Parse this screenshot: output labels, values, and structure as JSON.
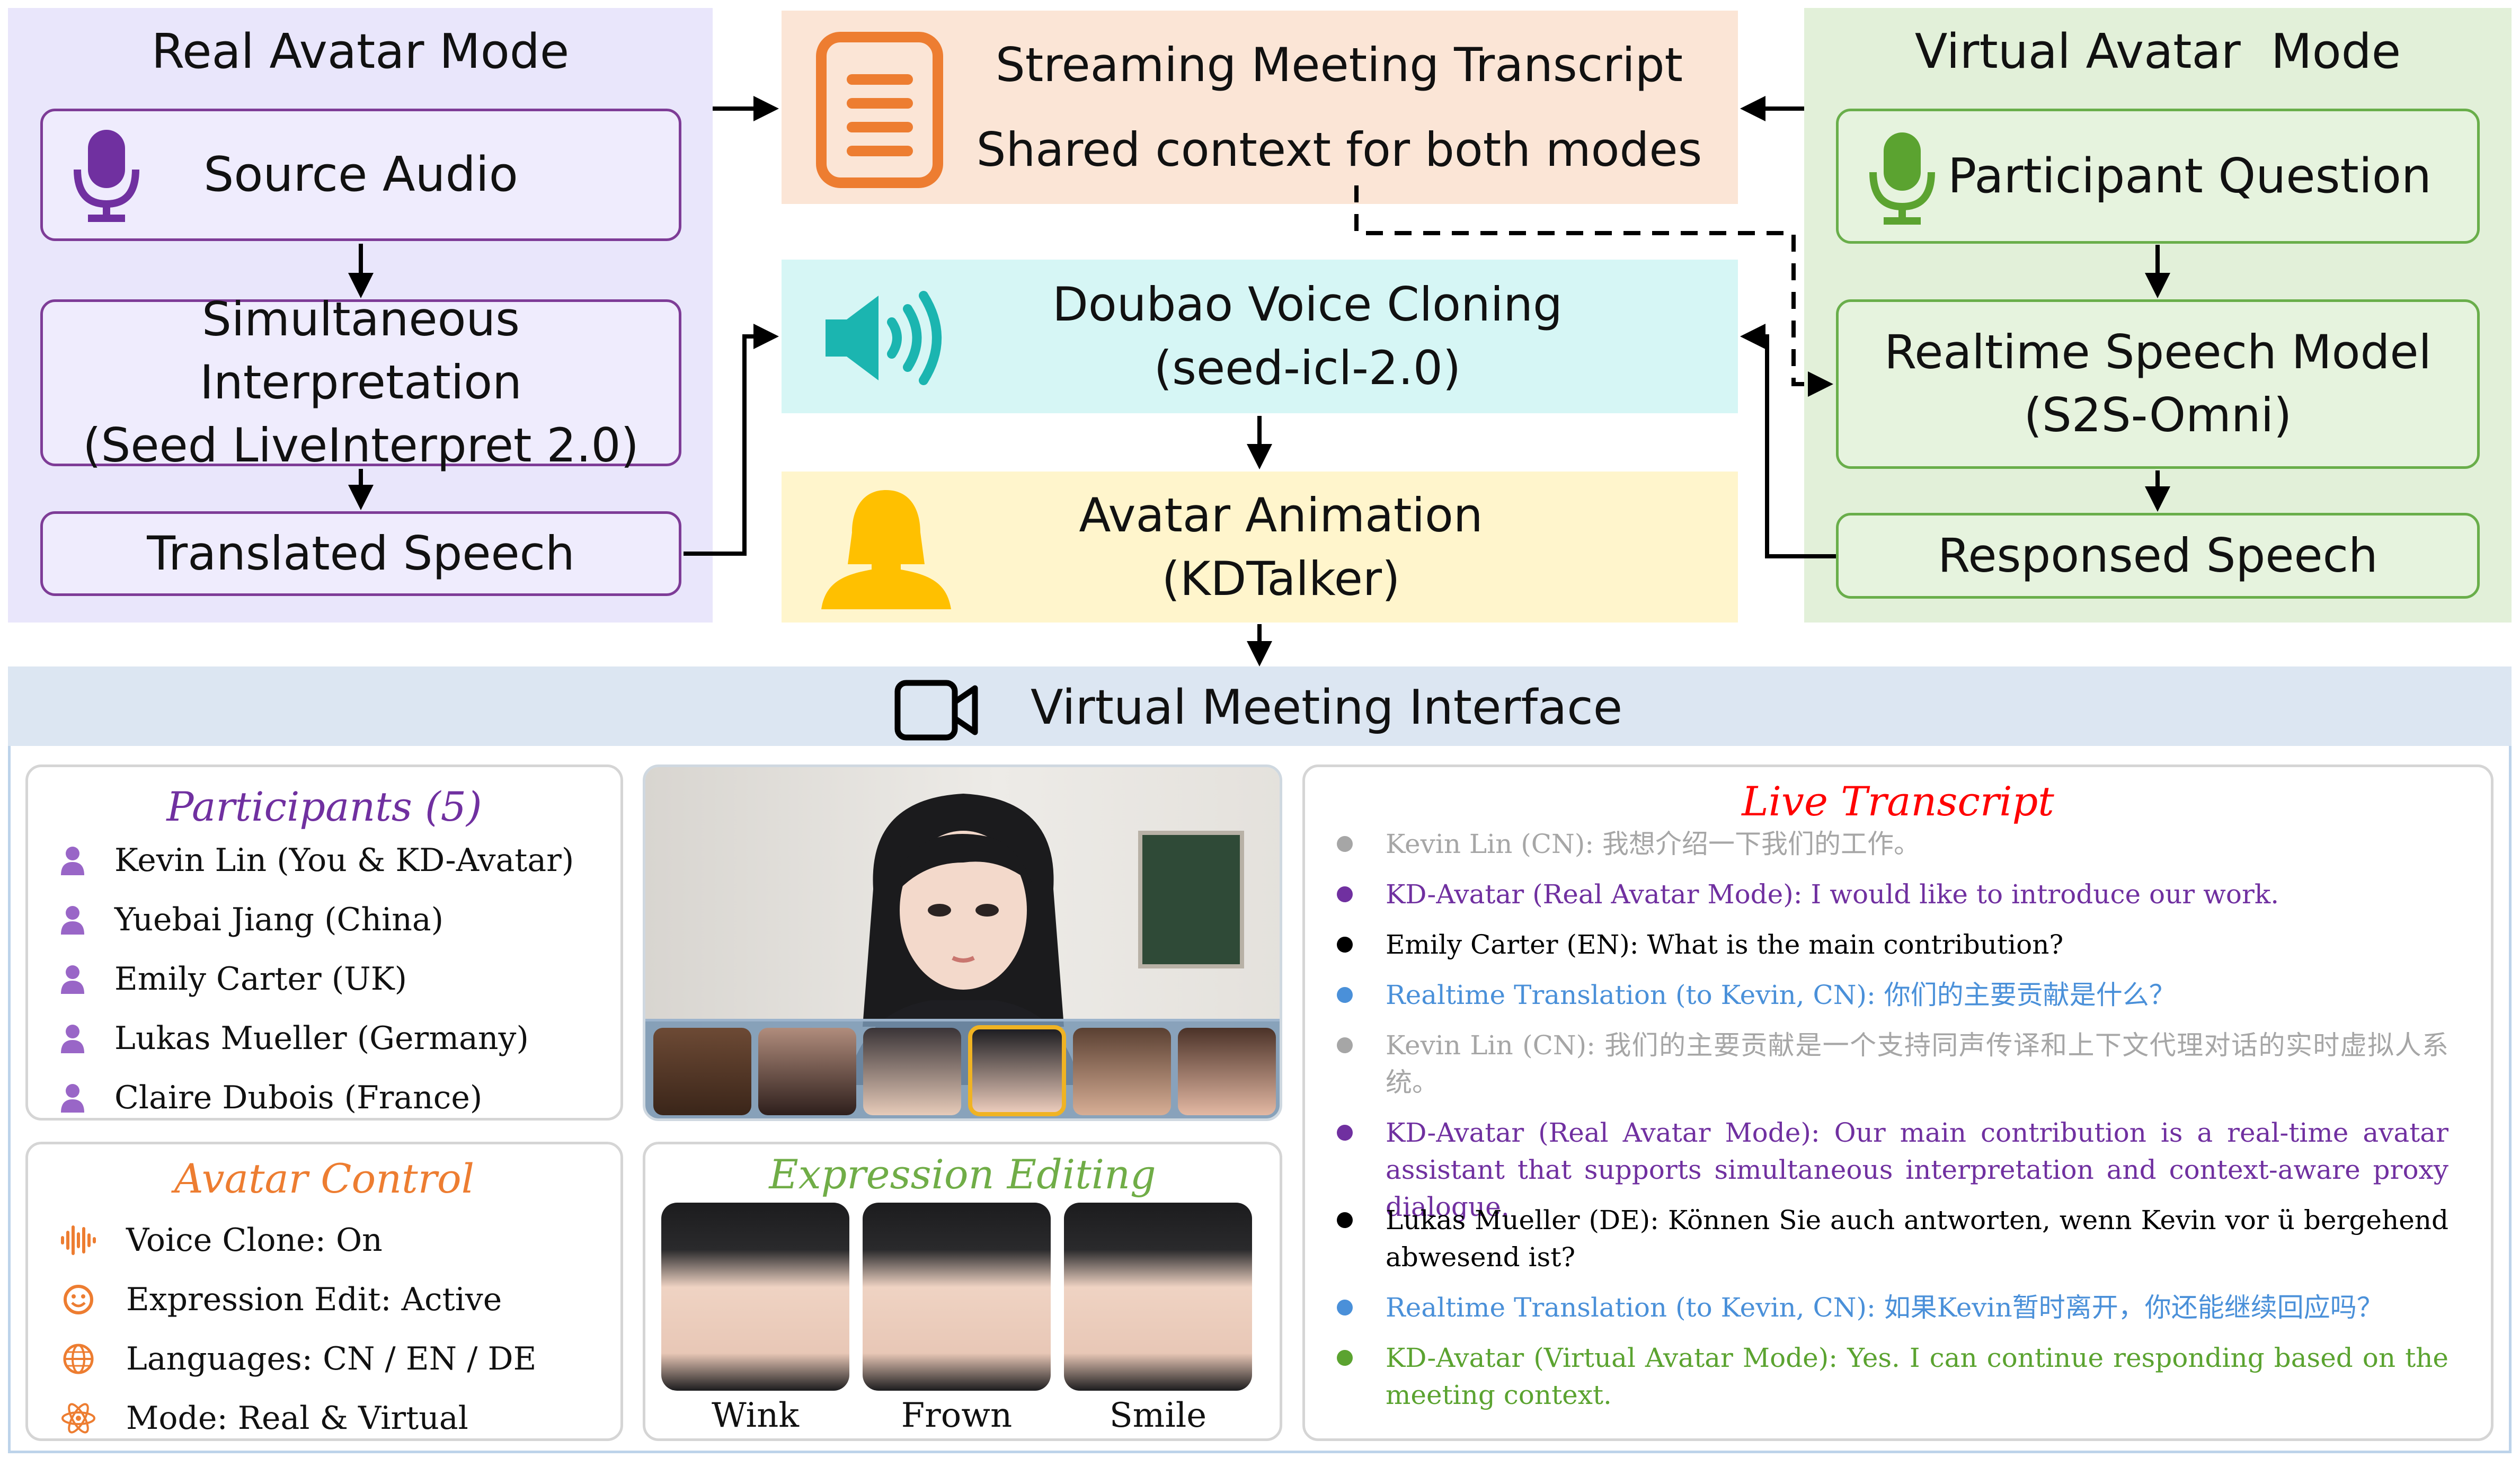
{
  "colors": {
    "real_panel": "#E9E6FB",
    "real_border": "#7E3C97",
    "virtual_panel": "#E2F0D9",
    "virtual_border": "#69AE4A",
    "transcript_box": "#FBE5D6",
    "transcript_icon": "#ED7D31",
    "voice_box": "#D6F6F5",
    "voice_icon": "#1BB5B0",
    "anim_box": "#FFF5CC",
    "anim_icon": "#FFC000",
    "interface_bar": "#DCE6F2",
    "interface_border": "#BDD3EA",
    "participants_title": "#7030A0",
    "avatar_control_title": "#ED7D31",
    "expression_title": "#70AD47",
    "live_title": "#FF0000",
    "gray": "#A6A6A6",
    "purple": "#7030A0",
    "black": "#000000",
    "blue": "#4A90D9",
    "green": "#5BA330"
  },
  "real_mode": {
    "title": "Real Avatar Mode",
    "source_audio": "Source Audio",
    "interpretation": "Simultaneous Interpretation\n(Seed LiveInterpret 2.0)",
    "translated": "Translated Speech",
    "icon": "microphone-icon"
  },
  "virtual_mode": {
    "title": "Virtual Avatar  Mode",
    "question": "Participant Question",
    "speech_model": "Realtime Speech Model\n(S2S-Omni)",
    "responsed": "Responsed Speech",
    "icon": "microphone-icon"
  },
  "center": {
    "transcript": "Streaming Meeting Transcript\nShared context for both modes",
    "voice": "Doubao Voice Cloning\n(seed-icl-2.0)",
    "animation": "Avatar Animation\n(KDTalker)"
  },
  "interface": {
    "title": "Virtual Meeting Interface",
    "icon": "video-camera-icon"
  },
  "participants": {
    "title": "Participants (5)",
    "items": [
      "Kevin Lin (You & KD-Avatar)",
      "Yuebai Jiang (China)",
      "Emily Carter (UK)",
      "Lukas Mueller (Germany)",
      "Claire Dubois (France)"
    ]
  },
  "avatar_control": {
    "title": "Avatar Control",
    "items": [
      {
        "icon": "waveform-icon",
        "text": "Voice Clone: On"
      },
      {
        "icon": "smiley-icon",
        "text": "Expression Edit: Active"
      },
      {
        "icon": "globe-icon",
        "text": "Languages: CN / EN / DE"
      },
      {
        "icon": "atom-icon",
        "text": "Mode: Real & Virtual"
      }
    ]
  },
  "expression": {
    "title": "Expression Editing",
    "labels": [
      "Wink",
      "Frown",
      "Smile"
    ]
  },
  "live_transcript": {
    "title": "Live Transcript",
    "lines": [
      {
        "color": "#A6A6A6",
        "text": "Kevin Lin (CN): 我想介绍一下我们的工作。"
      },
      {
        "color": "#7030A0",
        "text": "KD-Avatar (Real Avatar Mode): I would like to introduce our work."
      },
      {
        "color": "#000000",
        "text": "Emily Carter (EN): What is the main contribution?"
      },
      {
        "color": "#4A90D9",
        "text": "Realtime Translation (to Kevin, CN): 你们的主要贡献是什么？"
      },
      {
        "color": "#A6A6A6",
        "text": "Kevin Lin (CN): 我们的主要贡献是一个支持同声传译和上下文代理对话的实时虚拟人系统。"
      },
      {
        "color": "#7030A0",
        "text": "KD-Avatar (Real Avatar Mode): Our main contribution is a real-time avatar assistant that supports simultaneous interpretation and context-aware proxy dialogue."
      },
      {
        "color": "#000000",
        "text": "Lukas Mueller (DE): Können Sie auch antworten, wenn Kevin vor ü bergehend abwesend ist?"
      },
      {
        "color": "#4A90D9",
        "text": "Realtime Translation (to Kevin, CN): 如果Kevin暂时离开，你还能继续回应吗？"
      },
      {
        "color": "#5BA330",
        "text": "KD-Avatar (Virtual Avatar Mode): Yes. I can continue responding based on the meeting context."
      }
    ]
  }
}
